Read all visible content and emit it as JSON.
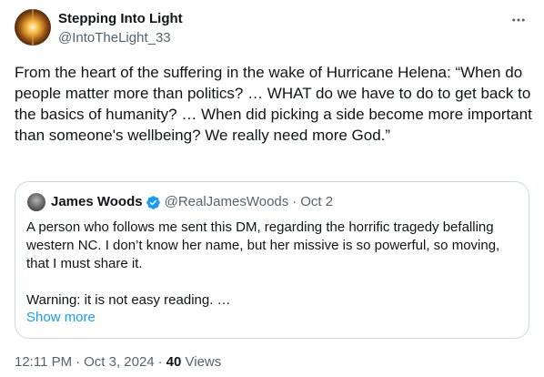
{
  "author": {
    "name": "Stepping Into Light",
    "handle": "@IntoTheLight_33"
  },
  "tweet": {
    "text": "From the heart of the suffering in the wake of Hurricane Helena: “When do people matter more than politics? … WHAT do we have to do to get back to the basics of humanity? … When did picking a side become more important than someone's wellbeing? We really need more God.”"
  },
  "quoted": {
    "name": "James Woods",
    "handle": "@RealJamesWoods",
    "separator": "·",
    "date": "Oct 2",
    "paragraph1": "A person who follows me sent this DM, regarding the horrific tragedy befalling western NC. I don’t know her name, but her missive is so powerful, so moving, that I must share it.",
    "paragraph2": "Warning: it is not easy reading. …",
    "show_more": "Show more",
    "verified_color": "#1d9bf0"
  },
  "meta": {
    "time": "12:11 PM",
    "separator": "·",
    "date": "Oct 3, 2024",
    "views_count": "40",
    "views_label": "Views"
  },
  "icons": {
    "more": "more-horizontal-icon",
    "verified": "verified-badge-icon"
  },
  "colors": {
    "text": "#0f1419",
    "secondary": "#536471",
    "accent": "#1d9bf0",
    "border": "#cfd9de"
  }
}
